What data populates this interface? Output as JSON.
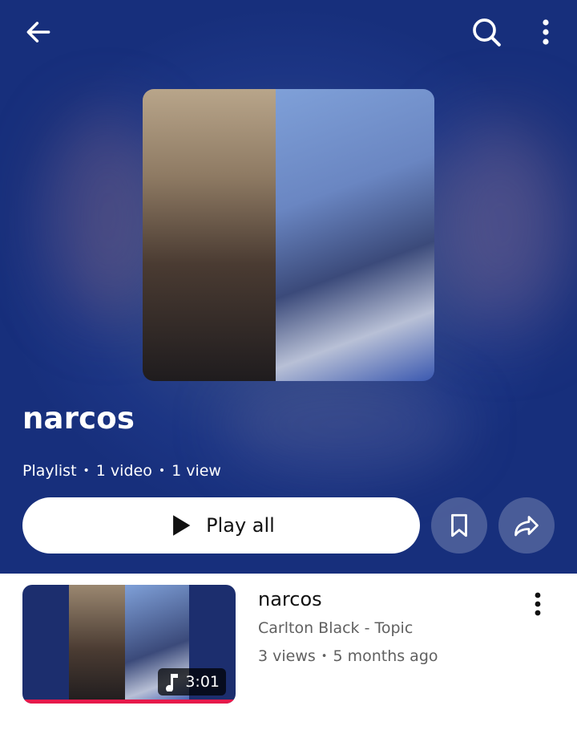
{
  "header": {
    "back_icon": "arrow-left-icon",
    "search_icon": "search-icon",
    "more_icon": "more-vert-icon"
  },
  "playlist": {
    "title": "narcos",
    "type": "Playlist",
    "video_count": "1 video",
    "view_count": "1 view",
    "play_all_label": "Play all",
    "save_icon": "bookmark-icon",
    "share_icon": "share-icon"
  },
  "videos": [
    {
      "title": "narcos",
      "channel": "Carlton Black - Topic",
      "views": "3 views",
      "age": "5 months ago",
      "duration": "3:01",
      "progress": 1.0
    }
  ],
  "colors": {
    "header_bg": "#1c3584",
    "progress": "#e6194b"
  }
}
